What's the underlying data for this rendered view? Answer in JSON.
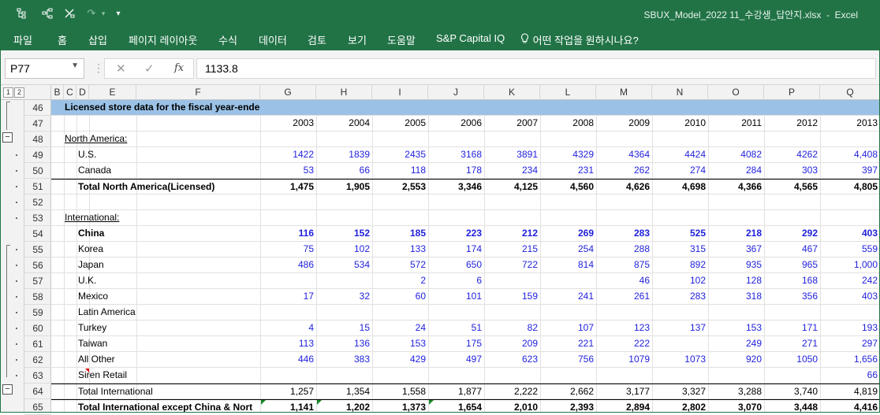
{
  "titlebar": {
    "title": "SBUX_Model_2022 11_수강생_답안지.xlsx  -  Excel",
    "qa": [
      "outline-icon",
      "hierarchy-icon",
      "ungroup-icon",
      "redo-icon",
      "customize-dropdown-icon"
    ]
  },
  "ribbon": {
    "tabs": [
      "파일",
      "홈",
      "삽입",
      "페이지 레이아웃",
      "수식",
      "데이터",
      "검토",
      "보기",
      "도움말",
      "S&P Capital IQ",
      "어떤 작업을 원하시나요?"
    ]
  },
  "formula_bar": {
    "name_box": "P77",
    "fx_label": "fx",
    "value": "1133.8"
  },
  "outline_levels": [
    "1",
    "2"
  ],
  "columns": [
    "B",
    "C",
    "D",
    "E",
    "F",
    "G",
    "H",
    "I",
    "J",
    "K",
    "L",
    "M",
    "N",
    "O",
    "P",
    "Q"
  ],
  "rows": [
    {
      "num": "46",
      "label": "Licensed store data for the fiscal year-ended",
      "values": []
    },
    {
      "num": "47",
      "label": "",
      "values": [
        "2003",
        "2004",
        "2005",
        "2006",
        "2007",
        "2008",
        "2009",
        "2010",
        "2011",
        "2012",
        "2013"
      ]
    },
    {
      "num": "48",
      "label": "North America:",
      "values": []
    },
    {
      "num": "49",
      "label": "U.S.",
      "values": [
        "1422",
        "1839",
        "2435",
        "3168",
        "3891",
        "4329",
        "4364",
        "4424",
        "4082",
        "4262",
        "4,408"
      ]
    },
    {
      "num": "50",
      "label": "Canada",
      "values": [
        "53",
        "66",
        "118",
        "178",
        "234",
        "231",
        "262",
        "274",
        "284",
        "303",
        "397"
      ]
    },
    {
      "num": "51",
      "label": "Total North America(Licensed)",
      "values": [
        "1,475",
        "1,905",
        "2,553",
        "3,346",
        "4,125",
        "4,560",
        "4,626",
        "4,698",
        "4,366",
        "4,565",
        "4,805"
      ]
    },
    {
      "num": "52",
      "label": "",
      "values": []
    },
    {
      "num": "53",
      "label": "International:",
      "values": []
    },
    {
      "num": "54",
      "label": "China",
      "values": [
        "116",
        "152",
        "185",
        "223",
        "212",
        "269",
        "283",
        "525",
        "218",
        "292",
        "403"
      ]
    },
    {
      "num": "55",
      "label": "Korea",
      "values": [
        "75",
        "102",
        "133",
        "174",
        "215",
        "254",
        "288",
        "315",
        "367",
        "467",
        "559"
      ]
    },
    {
      "num": "56",
      "label": "Japan",
      "values": [
        "486",
        "534",
        "572",
        "650",
        "722",
        "814",
        "875",
        "892",
        "935",
        "965",
        "1,000"
      ]
    },
    {
      "num": "57",
      "label": "U.K.",
      "values": [
        "",
        "",
        "2",
        "6",
        "",
        "",
        "46",
        "102",
        "128",
        "168",
        "242"
      ]
    },
    {
      "num": "58",
      "label": "Mexico",
      "values": [
        "17",
        "32",
        "60",
        "101",
        "159",
        "241",
        "261",
        "283",
        "318",
        "356",
        "403"
      ]
    },
    {
      "num": "59",
      "label": "Latin America",
      "values": []
    },
    {
      "num": "60",
      "label": "Turkey",
      "values": [
        "4",
        "15",
        "24",
        "51",
        "82",
        "107",
        "123",
        "137",
        "153",
        "171",
        "193"
      ]
    },
    {
      "num": "61",
      "label": "Taiwan",
      "values": [
        "113",
        "136",
        "153",
        "175",
        "209",
        "221",
        "222",
        "",
        "249",
        "271",
        "297"
      ]
    },
    {
      "num": "62",
      "label": "All Other",
      "values": [
        "446",
        "383",
        "429",
        "497",
        "623",
        "756",
        "1079",
        "1073",
        "920",
        "1050",
        "1,656"
      ]
    },
    {
      "num": "63",
      "label": "Siren Retail",
      "values": [
        "",
        "",
        "",
        "",
        "",
        "",
        "",
        "",
        "",
        "",
        "66"
      ]
    },
    {
      "num": "64",
      "label": "Total International",
      "values": [
        "1,257",
        "1,354",
        "1,558",
        "1,877",
        "2,222",
        "2,662",
        "3,177",
        "3,327",
        "3,288",
        "3,740",
        "4,819"
      ]
    },
    {
      "num": "65",
      "label": "Total International except China & Nort",
      "values": [
        "1,141",
        "1,202",
        "1,373",
        "1,654",
        "2,010",
        "2,393",
        "2,894",
        "2,802",
        "3,070",
        "3,448",
        "4,416"
      ]
    }
  ],
  "colors": {
    "excel_green": "#217346",
    "header_fill": "#9bc2e6",
    "input_blue": "#1f1fdc"
  }
}
